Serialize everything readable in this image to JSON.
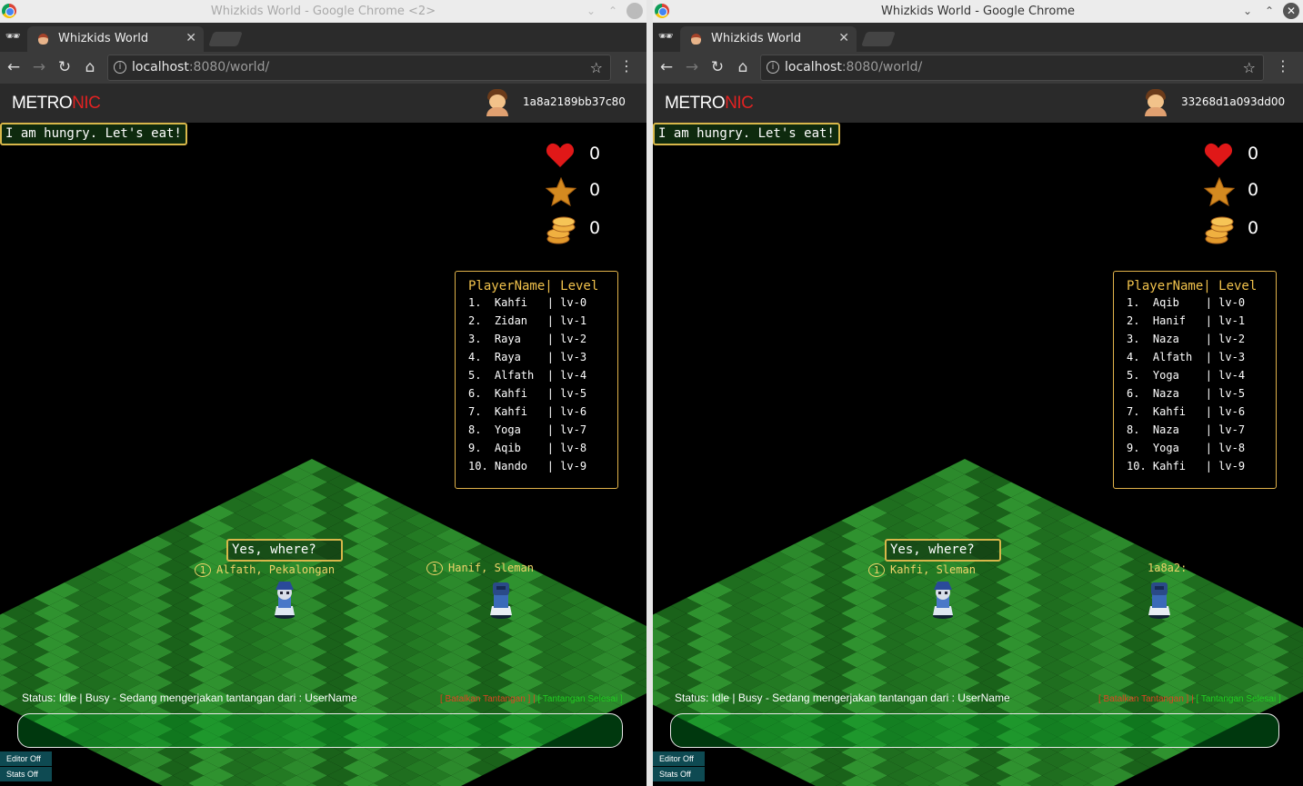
{
  "colors": {
    "accent_red": "#e02222",
    "board_border": "#e0b24a",
    "grass_light": "#2f8a2f",
    "grass_dark": "#1d6b1d"
  },
  "windows": [
    {
      "window_title": "Whizkids World - Google Chrome <2>",
      "tab_label": "Whizkids World",
      "url_host": "localhost",
      "url_path": ":8080/world/",
      "brand_a": "METRO",
      "brand_b": "NIC",
      "username": "1a8a2189bb37c80",
      "stats": {
        "hearts": "0",
        "stars": "0",
        "coins": "0"
      },
      "leaderboard": {
        "header": "PlayerName| Level",
        "rows": [
          "1.  Kahfi   | lv-0",
          "2.  Zidan   | lv-1",
          "3.  Raya    | lv-2",
          "4.  Raya    | lv-3",
          "5.  Alfath  | lv-4",
          "6.  Kahfi   | lv-5",
          "7.  Kahfi   | lv-6",
          "8.  Yoga    | lv-7",
          "9.  Aqib    | lv-8",
          "10. Nando   | lv-9"
        ]
      },
      "bubble1": "Yes, where?",
      "bubble2": "I am hungry. Let's eat!",
      "tag1_level": "1",
      "tag1_text": "Alfath, Pekalongan",
      "tag2_level": "1",
      "tag2_text": "Hanif, Sleman",
      "status": "Status: Idle | Busy - Sedang mengerjakan tantangan dari : UserName",
      "btn_cancel": "[ Batalkan Tantangan ]",
      "btn_sep": "|",
      "btn_done": "[ Tantangan Selesai ]",
      "editor_btn": "Editor Off",
      "stats_btn": "Stats Off"
    },
    {
      "window_title": "Whizkids World - Google Chrome",
      "tab_label": "Whizkids World",
      "url_host": "localhost",
      "url_path": ":8080/world/",
      "brand_a": "METRO",
      "brand_b": "NIC",
      "username": "33268d1a093dd00",
      "stats": {
        "hearts": "0",
        "stars": "0",
        "coins": "0"
      },
      "leaderboard": {
        "header": "PlayerName| Level",
        "rows": [
          "1.  Aqib    | lv-0",
          "2.  Hanif   | lv-1",
          "3.  Naza    | lv-2",
          "4.  Alfath  | lv-3",
          "5.  Yoga    | lv-4",
          "6.  Naza    | lv-5",
          "7.  Kahfi   | lv-6",
          "8.  Naza    | lv-7",
          "9.  Yoga    | lv-8",
          "10. Kahfi   | lv-9"
        ]
      },
      "bubble1": "Yes, where?",
      "bubble2": "I am hungry. Let's eat!",
      "tag1_level": "1",
      "tag1_text": "Kahfi, Sleman",
      "tag2_level": "",
      "tag2_text": "1a8a2:",
      "status": "Status: Idle | Busy - Sedang mengerjakan tantangan dari : UserName",
      "btn_cancel": "[ Batalkan Tantangan ]",
      "btn_sep": "|",
      "btn_done": "[ Tantangan Selesai ]",
      "editor_btn": "Editor Off",
      "stats_btn": "Stats Off"
    }
  ]
}
